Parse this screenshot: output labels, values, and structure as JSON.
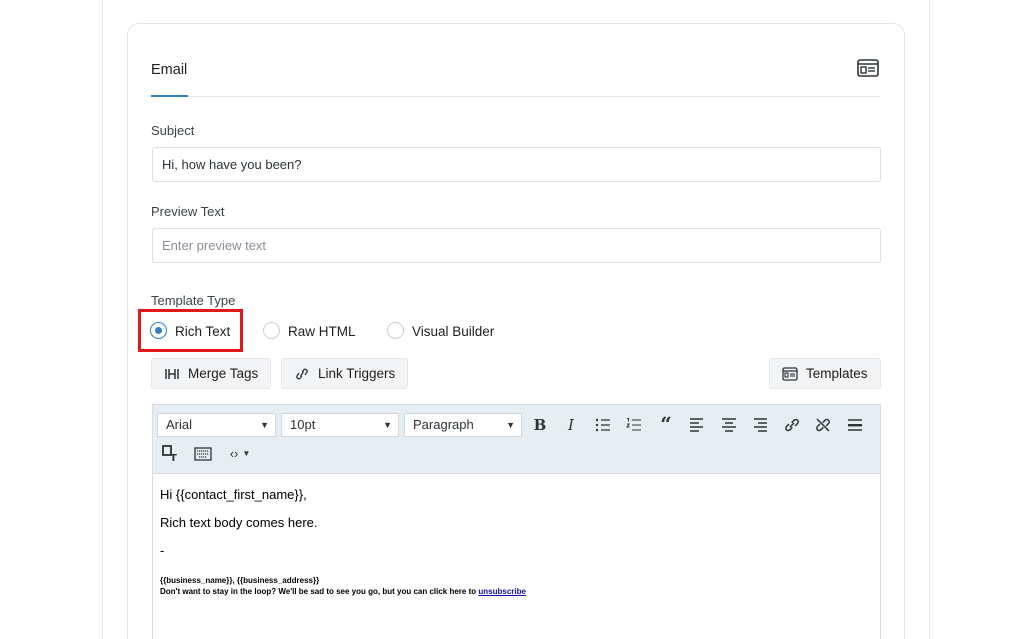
{
  "tabs": {
    "active": "Email"
  },
  "icons": {
    "card_layout": "layout-icon",
    "merge_tags": "merge-tags-icon",
    "link_triggers": "link-icon",
    "templates": "templates-icon"
  },
  "subject": {
    "label": "Subject",
    "value": "Hi, how have you been?"
  },
  "preview_text": {
    "label": "Preview Text",
    "placeholder": "Enter preview text"
  },
  "template_type": {
    "label": "Template Type",
    "options": [
      "Rich Text",
      "Raw HTML",
      "Visual Builder"
    ],
    "selected": "Rich Text"
  },
  "actions": {
    "merge_tags": "Merge Tags",
    "link_triggers": "Link Triggers",
    "templates": "Templates"
  },
  "toolbar": {
    "font_family": "Arial",
    "font_size": "10pt",
    "block_format": "Paragraph"
  },
  "content": {
    "greeting": "Hi {{contact_first_name}},",
    "body": "Rich text body comes here.",
    "separator": "-",
    "footer_line1": "{{business_name}}, {{business_address}}",
    "footer_line2": "Don't want to stay in the loop? We'll be sad to see you go, but you can click here to",
    "unsubscribe": "unsubscribe"
  },
  "colors": {
    "accent": "#2f7fd1",
    "highlight": "#e01a1a",
    "toolbar_bg": "#e7eef3"
  }
}
